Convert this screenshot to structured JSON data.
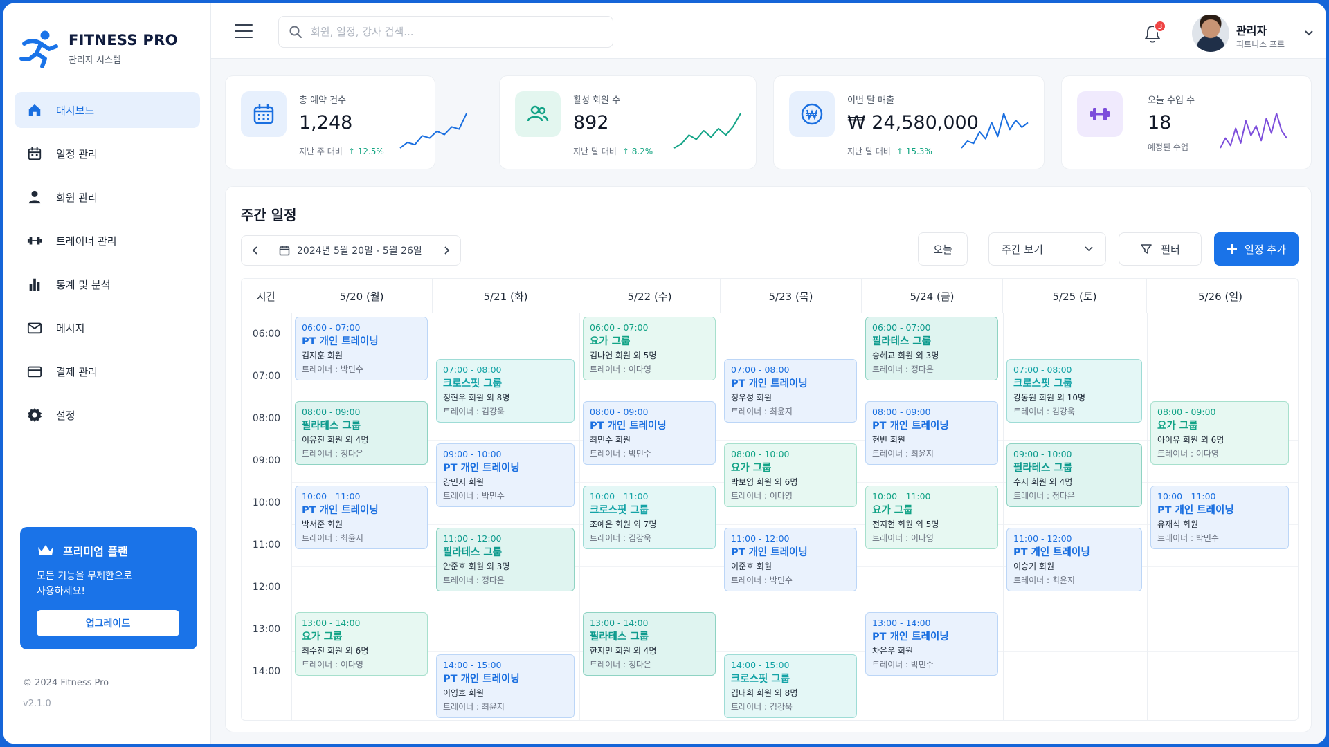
{
  "brand": {
    "title": "FITNESS PRO",
    "subtitle": "관리자 시스템"
  },
  "sidebar": {
    "items": [
      {
        "label": "대시보드",
        "icon": "home-icon",
        "active": true
      },
      {
        "label": "일정 관리",
        "icon": "calendar-icon"
      },
      {
        "label": "회원 관리",
        "icon": "user-icon"
      },
      {
        "label": "트레이너 관리",
        "icon": "dumbbell-icon"
      },
      {
        "label": "통계 및 분석",
        "icon": "bar-chart-icon"
      },
      {
        "label": "메시지",
        "icon": "mail-icon"
      },
      {
        "label": "결제 관리",
        "icon": "credit-card-icon"
      },
      {
        "label": "설정",
        "icon": "gear-icon"
      }
    ],
    "premium": {
      "title": "프리미엄 플랜",
      "desc_line1": "모든 기능을 무제한으로",
      "desc_line2": "사용하세요!",
      "button": "업그레이드"
    },
    "copyright": "© 2024 Fitness Pro",
    "version": "v2.1.0"
  },
  "topbar": {
    "search_placeholder": "회원, 일정, 강사 검색...",
    "notification_count": "3",
    "user_name": "관리자",
    "user_role": "피트니스 프로"
  },
  "stats": [
    {
      "label": "총 예약 건수",
      "value": "1,248",
      "compare": "지난 주 대비",
      "change": "↑ 12.5%",
      "icon": "calendar-icon",
      "color": "#1a6fe0",
      "bg": "#e7f0fd",
      "trend": [
        3,
        8,
        6,
        14,
        12,
        18,
        15,
        22,
        20,
        34
      ]
    },
    {
      "label": "활성 회원 수",
      "value": "892",
      "compare": "지난 달 대비",
      "change": "↑ 8.2%",
      "icon": "users-icon",
      "color": "#12a386",
      "bg": "#e3f6ef",
      "trend": [
        2,
        6,
        14,
        10,
        18,
        12,
        20,
        14,
        22,
        34
      ]
    },
    {
      "label": "이번 달 매출",
      "value": "₩ 24,580,000",
      "compare": "지난 달 대비",
      "change": "↑ 15.3%",
      "icon": "won-icon",
      "color": "#1a6fe0",
      "bg": "#e7f0fd",
      "trend": [
        4,
        10,
        8,
        18,
        12,
        26,
        14,
        34,
        20,
        28,
        22,
        26
      ]
    },
    {
      "label": "오늘 수업 수",
      "value": "18",
      "compare": "예정된 수업",
      "change": "",
      "icon": "dumbbell-icon",
      "color": "#7c4ddb",
      "bg": "#f0eafd",
      "trend": [
        6,
        14,
        8,
        22,
        10,
        28,
        16,
        24,
        12,
        30,
        18,
        34,
        20,
        14
      ]
    }
  ],
  "schedule": {
    "title": "주간 일정",
    "date_range": "2024년 5월 20일 - 5월 26일",
    "today_label": "오늘",
    "view_label": "주간 보기",
    "filter_label": "필터",
    "add_label": "일정 추가",
    "time_header": "시간",
    "days": [
      "5/20 (월)",
      "5/21 (화)",
      "5/22 (수)",
      "5/23 (목)",
      "5/24 (금)",
      "5/25 (토)",
      "5/26 (일)"
    ],
    "times": [
      "06:00",
      "07:00",
      "08:00",
      "09:00",
      "10:00",
      "11:00",
      "12:00",
      "13:00",
      "14:00"
    ],
    "events": [
      {
        "day": 0,
        "start": 6,
        "type": "pt",
        "time": "06:00 - 07:00",
        "title": "PT 개인 트레이닝",
        "member": "김지훈 회원",
        "trainer": "트레이너 : 박민수"
      },
      {
        "day": 0,
        "start": 8,
        "type": "pil",
        "time": "08:00 - 09:00",
        "title": "필라테스 그룹",
        "member": "이유진 회원 외 4명",
        "trainer": "트레이너 : 정다은"
      },
      {
        "day": 0,
        "start": 10,
        "type": "pt",
        "time": "10:00 - 11:00",
        "title": "PT 개인 트레이닝",
        "member": "박서준 회원",
        "trainer": "트레이너 : 최윤지"
      },
      {
        "day": 0,
        "start": 13,
        "type": "yoga",
        "time": "13:00 - 14:00",
        "title": "요가 그룹",
        "member": "최수진 회원 외 6명",
        "trainer": "트레이너 : 이다영"
      },
      {
        "day": 1,
        "start": 7,
        "type": "cf",
        "time": "07:00 - 08:00",
        "title": "크로스핏 그룹",
        "member": "정현우 회원 외 8명",
        "trainer": "트레이너 : 김강욱"
      },
      {
        "day": 1,
        "start": 9,
        "type": "pt",
        "time": "09:00 - 10:00",
        "title": "PT 개인 트레이닝",
        "member": "강민지 회원",
        "trainer": "트레이너 : 박민수"
      },
      {
        "day": 1,
        "start": 11,
        "type": "pil",
        "time": "11:00 - 12:00",
        "title": "필라테스 그룹",
        "member": "안준호 회원 외 3명",
        "trainer": "트레이너 : 정다은"
      },
      {
        "day": 1,
        "start": 14,
        "type": "pt",
        "time": "14:00 - 15:00",
        "title": "PT 개인 트레이닝",
        "member": "이영호 회원",
        "trainer": "트레이너 : 최윤지"
      },
      {
        "day": 2,
        "start": 6,
        "type": "yoga",
        "time": "06:00 - 07:00",
        "title": "요가 그룹",
        "member": "김나연 회원 외 5명",
        "trainer": "트레이너 : 이다영"
      },
      {
        "day": 2,
        "start": 8,
        "type": "pt",
        "time": "08:00 - 09:00",
        "title": "PT 개인 트레이닝",
        "member": "최민수 회원",
        "trainer": "트레이너 : 박민수"
      },
      {
        "day": 2,
        "start": 10,
        "type": "cf",
        "time": "10:00 - 11:00",
        "title": "크로스핏 그룹",
        "member": "조예은 회원 외 7명",
        "trainer": "트레이너 : 김강욱"
      },
      {
        "day": 2,
        "start": 13,
        "type": "pil",
        "time": "13:00 - 14:00",
        "title": "필라테스 그룹",
        "member": "한지민 회원 외 4명",
        "trainer": "트레이너 : 정다은"
      },
      {
        "day": 3,
        "start": 7,
        "type": "pt",
        "time": "07:00 - 08:00",
        "title": "PT 개인 트레이닝",
        "member": "정우성 회원",
        "trainer": "트레이너 : 최윤지"
      },
      {
        "day": 3,
        "start": 9,
        "type": "yoga",
        "time": "08:00 - 10:00",
        "title": "요가 그룹",
        "member": "박보영 회원 외 6명",
        "trainer": "트레이너 : 이다영"
      },
      {
        "day": 3,
        "start": 11,
        "type": "pt",
        "time": "11:00 - 12:00",
        "title": "PT 개인 트레이닝",
        "member": "이준호 회원",
        "trainer": "트레이너 : 박민수"
      },
      {
        "day": 3,
        "start": 14,
        "type": "cf",
        "time": "14:00 - 15:00",
        "title": "크로스핏 그룹",
        "member": "김태희 회원 외 8명",
        "trainer": "트레이너 : 김강욱"
      },
      {
        "day": 4,
        "start": 6,
        "type": "pil",
        "time": "06:00 - 07:00",
        "title": "필라테스 그룹",
        "member": "송혜교 회원 외 3명",
        "trainer": "트레이너 : 정다은"
      },
      {
        "day": 4,
        "start": 8,
        "type": "pt",
        "time": "08:00 - 09:00",
        "title": "PT 개인 트레이닝",
        "member": "현빈 회원",
        "trainer": "트레이너 : 최윤지"
      },
      {
        "day": 4,
        "start": 10,
        "type": "yoga",
        "time": "10:00 - 11:00",
        "title": "요가 그룹",
        "member": "전지현 회원 외 5명",
        "trainer": "트레이너 : 이다영"
      },
      {
        "day": 4,
        "start": 13,
        "type": "pt",
        "time": "13:00 - 14:00",
        "title": "PT 개인 트레이닝",
        "member": "차은우 회원",
        "trainer": "트레이너 : 박민수"
      },
      {
        "day": 5,
        "start": 7,
        "type": "cf",
        "time": "07:00 - 08:00",
        "title": "크로스핏 그룹",
        "member": "강동원 회원 외 10명",
        "trainer": "트레이너 : 김강욱"
      },
      {
        "day": 5,
        "start": 9,
        "type": "pil",
        "time": "09:00 - 10:00",
        "title": "필라테스 그룹",
        "member": "수지 회원 외 4명",
        "trainer": "트레이너 : 정다은"
      },
      {
        "day": 5,
        "start": 11,
        "type": "pt",
        "time": "11:00 - 12:00",
        "title": "PT 개인 트레이닝",
        "member": "이승기 회원",
        "trainer": "트레이너 : 최윤지"
      },
      {
        "day": 6,
        "start": 8,
        "type": "yoga",
        "time": "08:00 - 09:00",
        "title": "요가 그룹",
        "member": "아이유 회원 외 6명",
        "trainer": "트레이너 : 이다영"
      },
      {
        "day": 6,
        "start": 10,
        "type": "pt",
        "time": "10:00 - 11:00",
        "title": "PT 개인 트레이닝",
        "member": "유재석 회원",
        "trainer": "트레이너 : 박민수"
      }
    ]
  }
}
